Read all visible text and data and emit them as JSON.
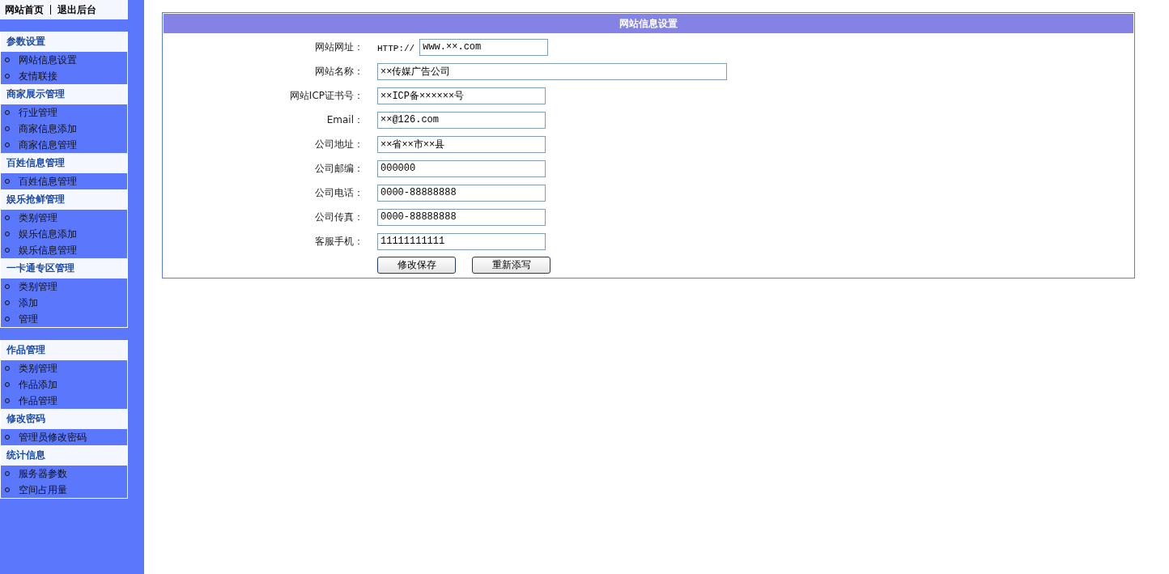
{
  "top_links": [
    "网站首页",
    "退出后台"
  ],
  "sidebar": {
    "sections": [
      {
        "groups": [
          {
            "title": "参数设置",
            "items": [
              "网站信息设置",
              "友情联接"
            ]
          },
          {
            "title": "商家展示管理",
            "items": [
              "行业管理",
              "商家信息添加",
              "商家信息管理"
            ]
          },
          {
            "title": "百姓信息管理",
            "items": [
              "百姓信息管理"
            ]
          },
          {
            "title": "娱乐抢鲜管理",
            "items": [
              "类别管理",
              "娱乐信息添加",
              "娱乐信息管理"
            ]
          },
          {
            "title": "一卡通专区管理",
            "items": [
              "类别管理",
              "添加",
              "管理"
            ]
          }
        ]
      },
      {
        "groups": [
          {
            "title": "作品管理",
            "items": [
              "类别管理",
              "作品添加",
              "作品管理"
            ]
          },
          {
            "title": "修改密码",
            "items": [
              "管理员修改密码"
            ]
          },
          {
            "title": "统计信息",
            "items": [
              "服务器参数",
              "空间占用量"
            ]
          }
        ]
      }
    ]
  },
  "form": {
    "title": "网站信息设置",
    "fields": [
      {
        "label": "网站网址：",
        "kind": "prefixed",
        "prefix": "HTTP://",
        "value": "www.××.com"
      },
      {
        "label": "网站名称：",
        "kind": "long",
        "value": "××传媒广告公司"
      },
      {
        "label": "网站ICP证书号：",
        "kind": "short",
        "value": "××ICP备××××××号"
      },
      {
        "label": "Email：",
        "kind": "short",
        "value": "××@126.com"
      },
      {
        "label": "公司地址：",
        "kind": "short",
        "value": "××省××市××县"
      },
      {
        "label": "公司邮编：",
        "kind": "short",
        "value": "000000"
      },
      {
        "label": "公司电话：",
        "kind": "short",
        "value": "0000-88888888"
      },
      {
        "label": "公司传真：",
        "kind": "short",
        "value": "0000-88888888"
      },
      {
        "label": "客服手机：",
        "kind": "short",
        "value": "11111111111"
      }
    ],
    "buttons": [
      "修改保存",
      "重新添写"
    ]
  }
}
